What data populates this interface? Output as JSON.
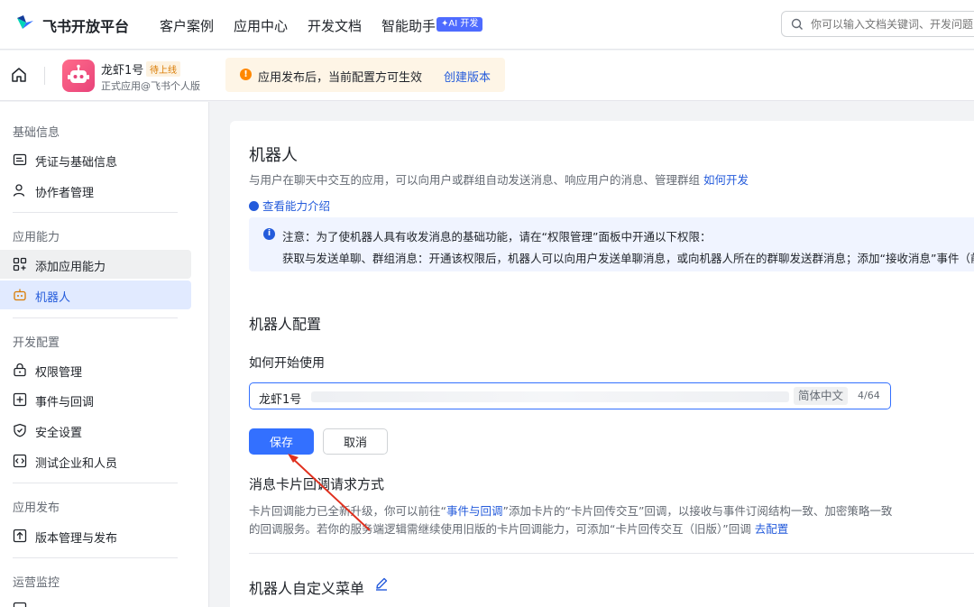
{
  "topnav": {
    "brand": "飞书开放平台",
    "items": [
      "客户案例",
      "应用中心",
      "开发文档",
      "智能助手"
    ],
    "ai_badge": "✦AI 开发",
    "search_placeholder": "你可以输入文档关键词、开发问题"
  },
  "app": {
    "name": "龙虾1号",
    "status": "待上线",
    "subtitle": "正式应用@飞书个人版",
    "notice": "应用发布后，当前配置方可生效",
    "create_version": "创建版本"
  },
  "sidebar": {
    "sections": [
      {
        "title": "基础信息",
        "items": [
          {
            "label": "凭证与基础信息",
            "icon": "credential-icon"
          },
          {
            "label": "协作者管理",
            "icon": "user-icon"
          }
        ]
      },
      {
        "title": "应用能力",
        "items": [
          {
            "label": "添加应用能力",
            "icon": "apps-icon"
          },
          {
            "label": "机器人",
            "icon": "robot-icon"
          }
        ]
      },
      {
        "title": "开发配置",
        "items": [
          {
            "label": "权限管理",
            "icon": "lock-icon"
          },
          {
            "label": "事件与回调",
            "icon": "event-icon"
          },
          {
            "label": "安全设置",
            "icon": "shield-icon"
          },
          {
            "label": "测试企业和人员",
            "icon": "code-icon"
          }
        ]
      },
      {
        "title": "应用发布",
        "items": [
          {
            "label": "版本管理与发布",
            "icon": "upload-icon"
          }
        ]
      },
      {
        "title": "运营监控",
        "items": []
      }
    ]
  },
  "main": {
    "title": "机器人",
    "desc": "与用户在聊天中交互的应用，可以向用户或群组自动发送消息、响应用户的消息、管理群组",
    "desc_link": "如何开发",
    "intro_link": "查看能力介绍",
    "info_line1": "注意：为了使机器人具有收发消息的基础功能，请在“权限管理”面板中开通以下权限：",
    "info_line2": "获取与发送单聊、群组消息：开通该权限后，机器人可以向用户发送单聊消息，或向机器人所在的群聊发送群消息；添加“接收消息”事件（前",
    "config_title": "机器人配置",
    "how_to_label": "如何开始使用",
    "input_value": "龙虾1号",
    "lang": "简体中文",
    "count": "4/64",
    "save": "保存",
    "cancel": "取消",
    "card_title": "消息卡片回调请求方式",
    "card_desc1_a": "卡片回调能力已全新升级，你可以前往“",
    "card_desc1_link": "事件与回调",
    "card_desc1_b": "”添加卡片的“卡片回传交互”回调，以接收与事件订阅结构一致、加密策略一致",
    "card_desc2": "的回调服务。若你的服务端逻辑需继续使用旧版的卡片回调能力，可添加“卡片回传交互（旧版）”回调",
    "card_desc2_link": "去配置",
    "menu_title": "机器人自定义菜单"
  }
}
